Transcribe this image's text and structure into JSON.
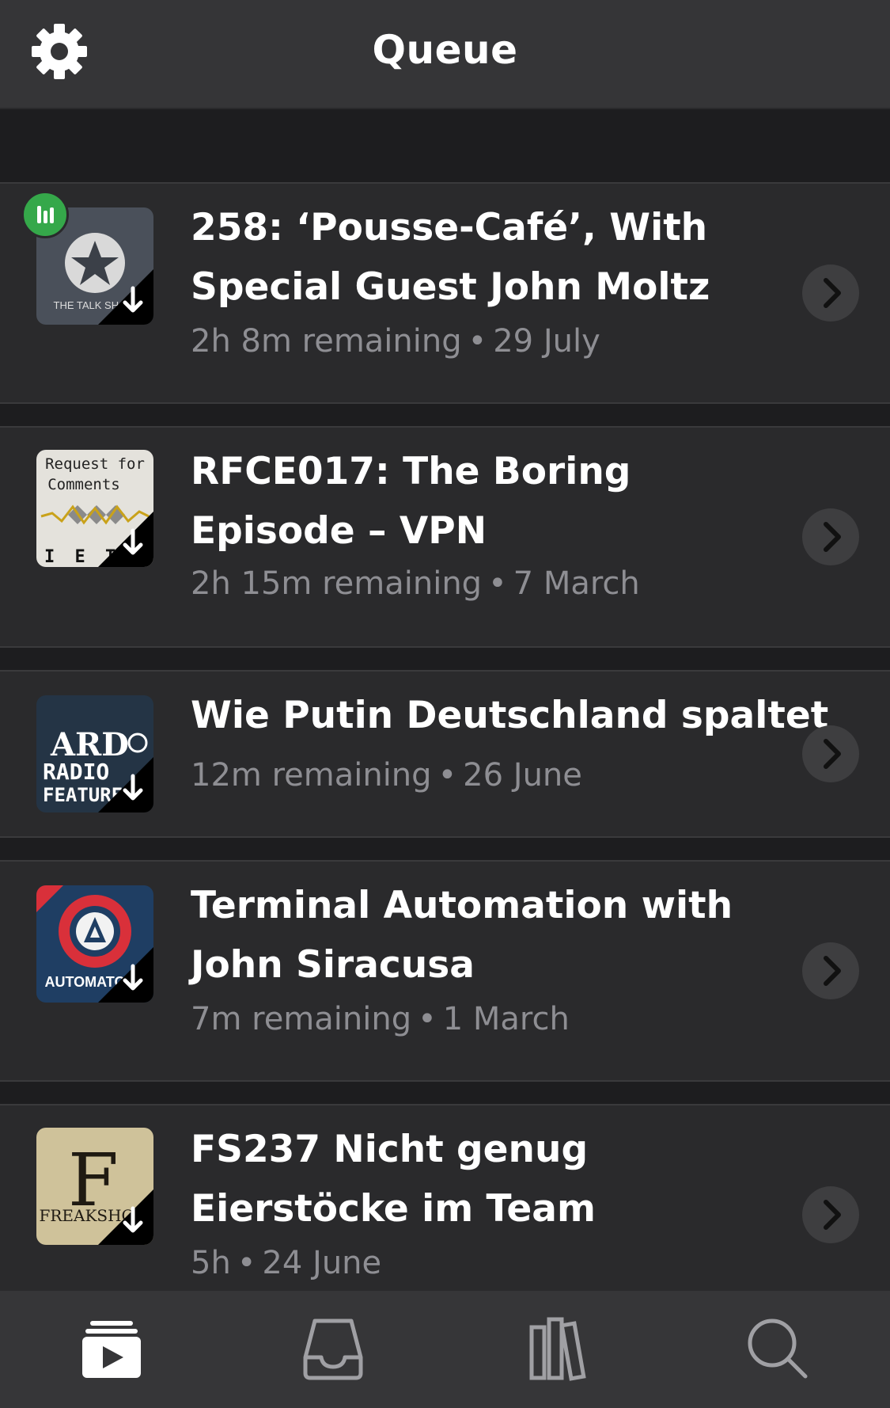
{
  "header": {
    "title": "Queue",
    "settings_icon": "gear-icon"
  },
  "episodes": [
    {
      "title": "258: ‘Pousse-Café’, With Special Guest John Moltz",
      "remaining": "2h 8m remaining",
      "date": "29 July",
      "artwork": "the-talk-show",
      "artwork_text": "THE TALK SHOW",
      "playing": true
    },
    {
      "title": "RFCE017: The Boring Episode – VPN",
      "remaining": "2h 15m remaining",
      "date": "7 March",
      "artwork": "request-for-comments",
      "artwork_text_1": "Request for",
      "artwork_text_2": "Comments",
      "artwork_text_3": "I E T"
    },
    {
      "title": "Wie Putin Deutschland spaltet",
      "remaining": "12m remaining",
      "date": "26 June",
      "artwork": "ard-radio-feature",
      "artwork_text_1": "ARD",
      "artwork_text_2": "RADIO",
      "artwork_text_3": "FEATURE"
    },
    {
      "title": "Terminal Automation with John Siracusa",
      "remaining": "7m remaining",
      "date": "1 March",
      "artwork": "automators",
      "artwork_text": "AUTOMATORS"
    },
    {
      "title": "FS237 Nicht genug Eierstöcke im Team",
      "remaining": "5h",
      "date": "24 June",
      "artwork": "freak-show",
      "artwork_text": "FREAKSHOW"
    }
  ],
  "separator": "•",
  "tabbar": {
    "items": [
      "queue-tab",
      "inbox-tab",
      "library-tab",
      "search-tab"
    ],
    "active": "queue-tab"
  },
  "colors": {
    "background": "#1d1d1f",
    "row": "#2a2a2c",
    "header": "#353537",
    "meta": "#8e8e93",
    "playing": "#35a84a"
  }
}
